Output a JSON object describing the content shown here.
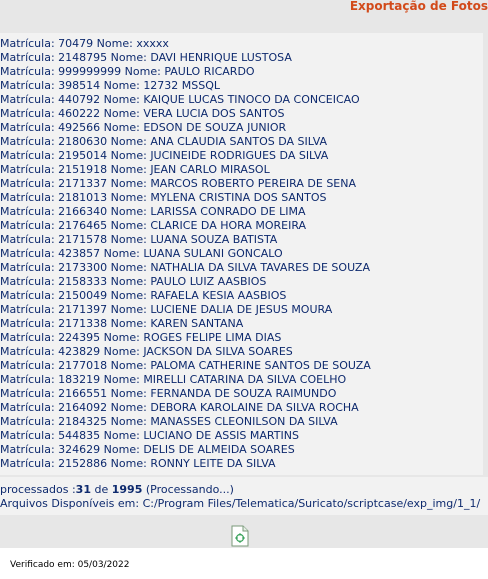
{
  "header": {
    "title": "Exportação de Fotos"
  },
  "log_entries": [
    {
      "label": "Matrícula:",
      "matricula": "70479",
      "nome_label": "Nome:",
      "nome": "xxxxx"
    },
    {
      "label": "Matrícula:",
      "matricula": "2148795",
      "nome_label": "Nome:",
      "nome": "DAVI HENRIQUE LUSTOSA"
    },
    {
      "label": "Matrícula:",
      "matricula": "999999999",
      "nome_label": "Nome:",
      "nome": "PAULO RICARDO"
    },
    {
      "label": "Matrícula:",
      "matricula": "398514",
      "nome_label": "Nome:",
      "nome": "12732 MSSQL"
    },
    {
      "label": "Matrícula:",
      "matricula": "440792",
      "nome_label": "Nome:",
      "nome": "KAIQUE LUCAS TINOCO DA CONCEICAO"
    },
    {
      "label": "Matrícula:",
      "matricula": "460222",
      "nome_label": "Nome:",
      "nome": "VERA LUCIA DOS SANTOS"
    },
    {
      "label": "Matrícula:",
      "matricula": "492566",
      "nome_label": "Nome:",
      "nome": "EDSON DE SOUZA JUNIOR"
    },
    {
      "label": "Matrícula:",
      "matricula": "2180630",
      "nome_label": "Nome:",
      "nome": "ANA CLAUDIA SANTOS DA SILVA"
    },
    {
      "label": "Matrícula:",
      "matricula": "2195014",
      "nome_label": "Nome:",
      "nome": "JUCINEIDE RODRIGUES DA SILVA"
    },
    {
      "label": "Matrícula:",
      "matricula": "2151918",
      "nome_label": "Nome:",
      "nome": "JEAN CARLO MIRASOL"
    },
    {
      "label": "Matrícula:",
      "matricula": "2171337",
      "nome_label": "Nome:",
      "nome": "MARCOS ROBERTO PEREIRA DE SENA"
    },
    {
      "label": "Matrícula:",
      "matricula": "2181013",
      "nome_label": "Nome:",
      "nome": "MYLENA CRISTINA DOS SANTOS"
    },
    {
      "label": "Matrícula:",
      "matricula": "2166340",
      "nome_label": "Nome:",
      "nome": "LARISSA CONRADO DE LIMA"
    },
    {
      "label": "Matrícula:",
      "matricula": "2176465",
      "nome_label": "Nome:",
      "nome": "CLARICE DA HORA MOREIRA"
    },
    {
      "label": "Matrícula:",
      "matricula": "2171578",
      "nome_label": "Nome:",
      "nome": "LUANA SOUZA BATISTA"
    },
    {
      "label": "Matrícula:",
      "matricula": "423857",
      "nome_label": "Nome:",
      "nome": "LUANA SULANI GONCALO"
    },
    {
      "label": "Matrícula:",
      "matricula": "2173300",
      "nome_label": "Nome:",
      "nome": "NATHALIA DA SILVA TAVARES DE SOUZA"
    },
    {
      "label": "Matrícula:",
      "matricula": "2158333",
      "nome_label": "Nome:",
      "nome": "PAULO LUIZ AASBIOS"
    },
    {
      "label": "Matrícula:",
      "matricula": "2150049",
      "nome_label": "Nome:",
      "nome": "RAFAELA KESIA AASBIOS"
    },
    {
      "label": "Matrícula:",
      "matricula": "2171397",
      "nome_label": "Nome:",
      "nome": "LUCIENE DALIA DE JESUS MOURA"
    },
    {
      "label": "Matrícula:",
      "matricula": "2171338",
      "nome_label": "Nome:",
      "nome": "KAREN SANTANA"
    },
    {
      "label": "Matrícula:",
      "matricula": "224395",
      "nome_label": "Nome:",
      "nome": "ROGES FELIPE LIMA DIAS"
    },
    {
      "label": "Matrícula:",
      "matricula": "423829",
      "nome_label": "Nome:",
      "nome": "JACKSON DA SILVA SOARES"
    },
    {
      "label": "Matrícula:",
      "matricula": "2177018",
      "nome_label": "Nome:",
      "nome": "PALOMA CATHERINE SANTOS DE SOUZA"
    },
    {
      "label": "Matrícula:",
      "matricula": "183219",
      "nome_label": "Nome:",
      "nome": "MIRELLI CATARINA DA SILVA COELHO"
    },
    {
      "label": "Matrícula:",
      "matricula": "2166551",
      "nome_label": "Nome:",
      "nome": "FERNANDA DE SOUZA RAIMUNDO"
    },
    {
      "label": "Matrícula:",
      "matricula": "2164092",
      "nome_label": "Nome:",
      "nome": "DEBORA KAROLAINE DA SILVA ROCHA"
    },
    {
      "label": "Matrícula:",
      "matricula": "2184325",
      "nome_label": "Nome:",
      "nome": "MANASSES CLEONILSON DA SILVA"
    },
    {
      "label": "Matrícula:",
      "matricula": "544835",
      "nome_label": "Nome:",
      "nome": "LUCIANO DE ASSIS MARTINS"
    },
    {
      "label": "Matrícula:",
      "matricula": "324629",
      "nome_label": "Nome:",
      "nome": "DELIS DE ALMEIDA SOARES"
    },
    {
      "label": "Matrícula:",
      "matricula": "2152886",
      "nome_label": "Nome:",
      "nome": "RONNY LEITE DA SILVA"
    }
  ],
  "status": {
    "prefix": "processados :",
    "processed": "31",
    "of_word": "de",
    "total": "1995",
    "state": "(Processando...)",
    "path_label": "Arquivos Disponíveis em:",
    "path": "C:/Program Files/Telematica/Suricato/scriptcase/exp_img/1_1/"
  },
  "export_icon": {
    "name": "export-file-icon",
    "accent": "#3aa35c"
  },
  "footer": {
    "verified": "Verificado em: 05/03/2022"
  },
  "colors": {
    "title": "#d24a1a",
    "text": "#0e2a6e",
    "panel": "#f2f2f2",
    "background": "#e7e7e7"
  }
}
